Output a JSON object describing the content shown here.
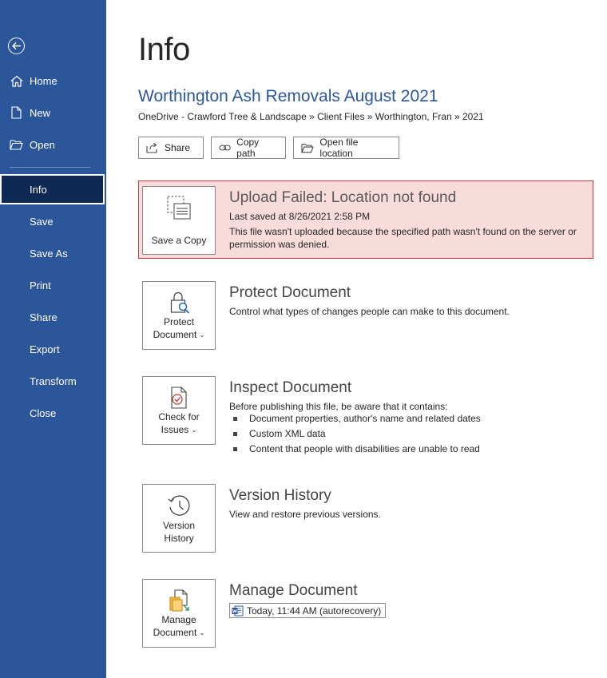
{
  "sidebar": {
    "items": [
      {
        "label": "Home",
        "icon": "home-icon"
      },
      {
        "label": "New",
        "icon": "new-document-icon"
      },
      {
        "label": "Open",
        "icon": "folder-open-icon"
      },
      {
        "label": "Info",
        "active": true
      },
      {
        "label": "Save"
      },
      {
        "label": "Save As"
      },
      {
        "label": "Print"
      },
      {
        "label": "Share"
      },
      {
        "label": "Export"
      },
      {
        "label": "Transform"
      },
      {
        "label": "Close"
      }
    ],
    "bg_color": "#2b579a",
    "active_color": "#0e2a54"
  },
  "page": {
    "title": "Info",
    "doc_title": "Worthington Ash Removals August 2021",
    "breadcrumb": "OneDrive - Crawford Tree & Landscape » Client Files » Worthington, Fran » 2021"
  },
  "toolbar": {
    "share_label": "Share",
    "copy_path_label": "Copy path",
    "open_location_label": "Open file location"
  },
  "upload_failed": {
    "tile_label": "Save a Copy",
    "title": "Upload Failed: Location not found",
    "last_saved": "Last saved at 8/26/2021 2:58 PM",
    "message": "This file wasn't uploaded because the specified path wasn't found on the server or permission was denied.",
    "bg_color": "#f8dcdc",
    "border_color": "#d13438"
  },
  "protect": {
    "tile_label": "Protect\nDocument",
    "title": "Protect Document",
    "description": "Control what types of changes people can make to this document."
  },
  "inspect": {
    "tile_label": "Check for\nIssues",
    "title": "Inspect Document",
    "description": "Before publishing this file, be aware that it contains:",
    "bullets": [
      "Document properties, author's name and related dates",
      "Custom XML data",
      "Content that people with disabilities are unable to read"
    ]
  },
  "version": {
    "tile_label": "Version\nHistory",
    "title": "Version History",
    "description": "View and restore previous versions."
  },
  "manage": {
    "tile_label": "Manage\nDocument",
    "title": "Manage Document",
    "autorecovery": "Today, 11:44 AM (autorecovery)"
  }
}
